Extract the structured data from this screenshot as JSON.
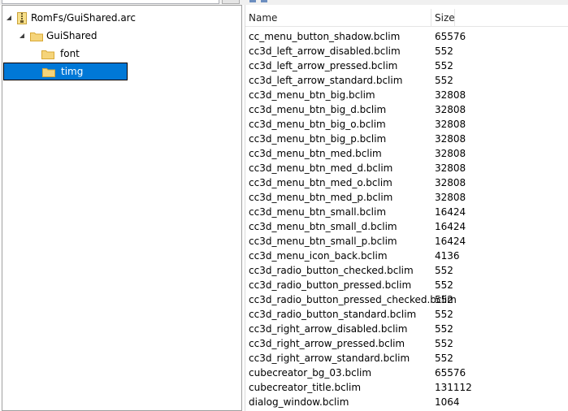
{
  "tree": {
    "root": {
      "label": "RomFs/GuiShared.arc"
    },
    "child": {
      "label": "GuiShared"
    },
    "folders": [
      {
        "label": "font",
        "selected": false
      },
      {
        "label": "timg",
        "selected": true
      }
    ]
  },
  "list": {
    "columns": {
      "name": "Name",
      "size": "Size"
    },
    "rows": [
      {
        "name": "cc_menu_button_shadow.bclim",
        "size": "65576"
      },
      {
        "name": "cc3d_left_arrow_disabled.bclim",
        "size": "552"
      },
      {
        "name": "cc3d_left_arrow_pressed.bclim",
        "size": "552"
      },
      {
        "name": "cc3d_left_arrow_standard.bclim",
        "size": "552"
      },
      {
        "name": "cc3d_menu_btn_big.bclim",
        "size": "32808"
      },
      {
        "name": "cc3d_menu_btn_big_d.bclim",
        "size": "32808"
      },
      {
        "name": "cc3d_menu_btn_big_o.bclim",
        "size": "32808"
      },
      {
        "name": "cc3d_menu_btn_big_p.bclim",
        "size": "32808"
      },
      {
        "name": "cc3d_menu_btn_med.bclim",
        "size": "32808"
      },
      {
        "name": "cc3d_menu_btn_med_d.bclim",
        "size": "32808"
      },
      {
        "name": "cc3d_menu_btn_med_o.bclim",
        "size": "32808"
      },
      {
        "name": "cc3d_menu_btn_med_p.bclim",
        "size": "32808"
      },
      {
        "name": "cc3d_menu_btn_small.bclim",
        "size": "16424"
      },
      {
        "name": "cc3d_menu_btn_small_d.bclim",
        "size": "16424"
      },
      {
        "name": "cc3d_menu_btn_small_p.bclim",
        "size": "16424"
      },
      {
        "name": "cc3d_menu_icon_back.bclim",
        "size": "4136"
      },
      {
        "name": "cc3d_radio_button_checked.bclim",
        "size": "552"
      },
      {
        "name": "cc3d_radio_button_pressed.bclim",
        "size": "552"
      },
      {
        "name": "cc3d_radio_button_pressed_checked.bclim",
        "size": "552"
      },
      {
        "name": "cc3d_radio_button_standard.bclim",
        "size": "552"
      },
      {
        "name": "cc3d_right_arrow_disabled.bclim",
        "size": "552"
      },
      {
        "name": "cc3d_right_arrow_pressed.bclim",
        "size": "552"
      },
      {
        "name": "cc3d_right_arrow_standard.bclim",
        "size": "552"
      },
      {
        "name": "cubecreator_bg_03.bclim",
        "size": "65576"
      },
      {
        "name": "cubecreator_title.bclim",
        "size": "131112"
      },
      {
        "name": "dialog_window.bclim",
        "size": "1064"
      }
    ]
  },
  "colors": {
    "selection": "#0078d7",
    "folder": "#f5d47a",
    "folder_edge": "#d9a936"
  }
}
